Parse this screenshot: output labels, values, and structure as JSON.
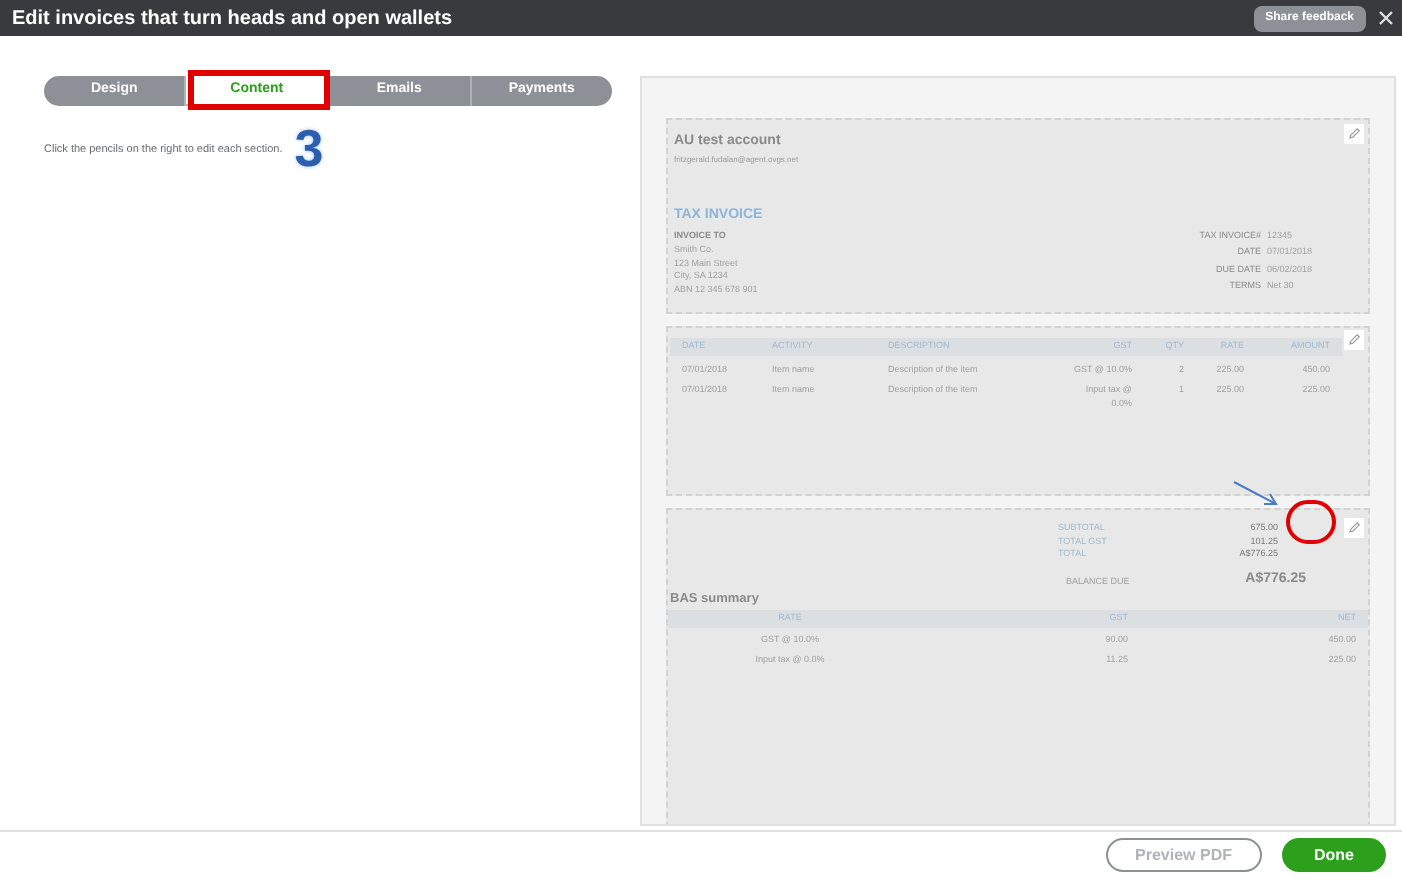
{
  "window": {
    "title": "Edit invoices that turn heads and open wallets",
    "share_feedback": "Share feedback"
  },
  "tabs": [
    {
      "label": "Design",
      "selected": false
    },
    {
      "label": "Content",
      "selected": true
    },
    {
      "label": "Emails",
      "selected": false
    },
    {
      "label": "Payments",
      "selected": false
    }
  ],
  "instruction": "Click the pencils on the right to edit each section.",
  "step_number": "3",
  "invoice": {
    "company": "AU test account",
    "email": "fritzgerald.fudalan@agent.ovgs.net",
    "title": "TAX INVOICE",
    "bill_to": {
      "label": "INVOICE TO",
      "lines": [
        "Smith Co.",
        "123 Main Street",
        "City, SA 1234",
        "ABN 12 345 678 901"
      ]
    },
    "meta": [
      {
        "label": "TAX INVOICE#",
        "value": "12345"
      },
      {
        "label": "DATE",
        "value": "07/01/2018"
      },
      {
        "label": "DUE DATE",
        "value": "06/02/2018"
      },
      {
        "label": "TERMS",
        "value": "Net 30"
      }
    ],
    "columns": [
      "DATE",
      "ACTIVITY",
      "DESCRIPTION",
      "GST",
      "QTY",
      "RATE",
      "AMOUNT"
    ],
    "rows": [
      [
        "07/01/2018",
        "Item name",
        "Description of the item",
        "GST @ 10.0%",
        "2",
        "225.00",
        "450.00"
      ],
      [
        "07/01/2018",
        "Item name",
        "Description of the item",
        "Input tax @ 0.0%",
        "1",
        "225.00",
        "225.00"
      ]
    ],
    "totals": [
      {
        "label": "SUBTOTAL",
        "value": "675.00"
      },
      {
        "label": "TOTAL GST",
        "value": "101.25"
      },
      {
        "label": "TOTAL",
        "value": "A$776.25"
      }
    ],
    "balance": {
      "label": "BALANCE DUE",
      "value": "A$776.25"
    },
    "bas": {
      "title": "BAS summary",
      "columns": [
        "RATE",
        "GST",
        "NET"
      ],
      "rows": [
        [
          "GST @ 10.0%",
          "90.00",
          "450.00"
        ],
        [
          "Input tax @ 0.0%",
          "11.25",
          "225.00"
        ]
      ]
    }
  },
  "buttons": {
    "preview": "Preview PDF",
    "done": "Done"
  }
}
